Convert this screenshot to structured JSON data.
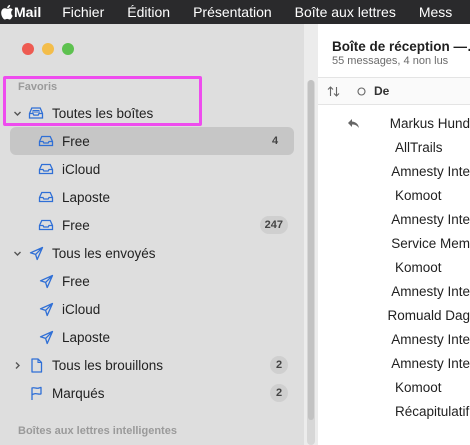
{
  "menubar": {
    "apple_icon": "apple-icon",
    "items": [
      "Mail",
      "Fichier",
      "Édition",
      "Présentation",
      "Boîte aux lettres",
      "Mess"
    ]
  },
  "sidebar": {
    "favorites_title": "Favoris",
    "smart_title": "Boîtes aux lettres intelligentes",
    "all_inboxes": {
      "label": "Toutes les boîtes",
      "icon": "tray-icon"
    },
    "inboxes": [
      {
        "label": "Free",
        "count": "4",
        "selected": true
      },
      {
        "label": "iCloud",
        "count": ""
      },
      {
        "label": "Laposte",
        "count": ""
      },
      {
        "label": "Free",
        "count": "247"
      }
    ],
    "all_sent": {
      "label": "Tous les envoyés",
      "icon": "paperplane-icon"
    },
    "sent": [
      {
        "label": "Free"
      },
      {
        "label": "iCloud"
      },
      {
        "label": "Laposte"
      }
    ],
    "all_drafts": {
      "label": "Tous les brouillons",
      "count": "2"
    },
    "flagged": {
      "label": "Marqués",
      "count": "2"
    }
  },
  "list": {
    "title": "Boîte de réception —…",
    "subtitle": "55 messages, 4 non lus",
    "col_from": "De",
    "messages": [
      {
        "from": "Markus Hund",
        "replied": true
      },
      {
        "from": "AllTrails"
      },
      {
        "from": "Amnesty Inte"
      },
      {
        "from": "Komoot"
      },
      {
        "from": "Amnesty Inte"
      },
      {
        "from": "Service Mem"
      },
      {
        "from": "Komoot"
      },
      {
        "from": "Amnesty Inte"
      },
      {
        "from": "Romuald Dag"
      },
      {
        "from": "Amnesty Inte"
      },
      {
        "from": "Amnesty Inte"
      },
      {
        "from": "Komoot"
      },
      {
        "from": "Récapitulatif"
      }
    ]
  },
  "colors": {
    "accent": "#2f6fd6",
    "highlight": "#ee4cee"
  }
}
